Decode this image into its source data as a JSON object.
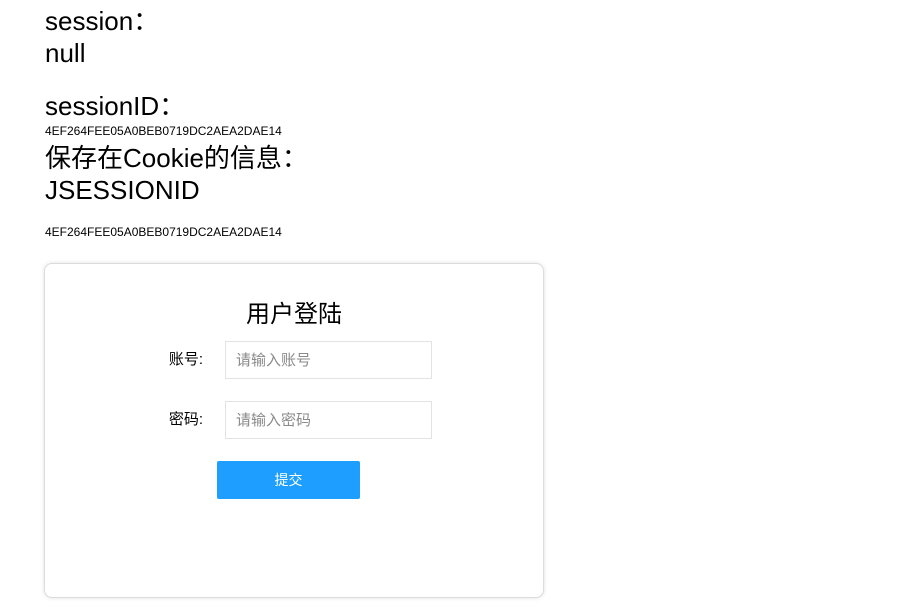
{
  "session": {
    "label": "session：",
    "value": "null"
  },
  "session_id": {
    "label": "sessionID：",
    "value": "4EF264FEE05A0BEB0719DC2AEA2DAE14"
  },
  "cookie": {
    "label": "保存在Cookie的信息：",
    "name": "JSESSIONID",
    "value": "4EF264FEE05A0BEB0719DC2AEA2DAE14"
  },
  "login": {
    "title": "用户登陆",
    "account_label": "账号:",
    "account_placeholder": "请输入账号",
    "account_value": "",
    "password_label": "密码:",
    "password_placeholder": "请输入密码",
    "password_value": "",
    "submit_label": "提交",
    "submit_color": "#1e9fff"
  }
}
